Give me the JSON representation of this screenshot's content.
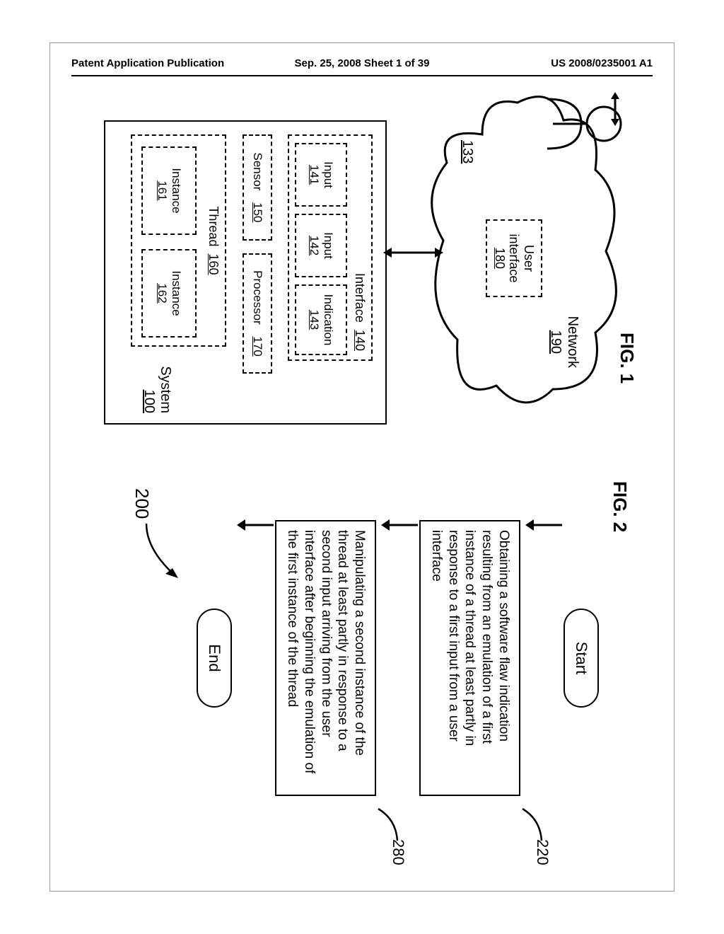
{
  "header": {
    "left": "Patent Application Publication",
    "mid": "Sep. 25, 2008  Sheet 1 of 39",
    "right": "US 2008/0235001 A1"
  },
  "fig1": {
    "label": "FIG. 1",
    "network": {
      "label": "Network",
      "num": "190"
    },
    "user_num": "133",
    "user_interface": {
      "line1": "User",
      "line2": "interface",
      "num": "180"
    },
    "system": {
      "label": "System",
      "num": "100"
    },
    "interface": {
      "label": "Interface",
      "num": "140",
      "input1": {
        "label": "Input",
        "num": "141"
      },
      "input2": {
        "label": "Input",
        "num": "142"
      },
      "indication": {
        "label": "Indication",
        "num": "143"
      }
    },
    "sensor": {
      "label": "Sensor",
      "num": "150"
    },
    "processor": {
      "label": "Processor",
      "num": "170"
    },
    "thread": {
      "label": "Thread",
      "num": "160",
      "instance1": {
        "label": "Instance",
        "num": "161"
      },
      "instance2": {
        "label": "Instance",
        "num": "162"
      }
    }
  },
  "fig2": {
    "label": "FIG. 2",
    "start": "Start",
    "end": "End",
    "ref": "200",
    "step1": {
      "num": "220",
      "text": "Obtaining a software flaw indication resulting from an emulation of a first instance of a thread at least partly in response to a first input from a user interface"
    },
    "step2": {
      "num": "280",
      "text": "Manipulating a second instance of the thread at least partly in response to a second input arriving from the user interface after beginning the emulation of the first instance of the thread"
    }
  }
}
